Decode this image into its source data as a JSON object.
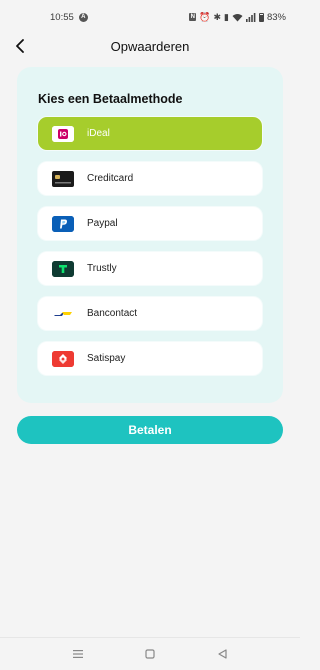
{
  "status_bar": {
    "time": "10:55",
    "alert_badge": "A",
    "nfc_badge": "N",
    "battery": "83%"
  },
  "header": {
    "title": "Opwaarderen"
  },
  "card": {
    "heading": "Kies een Betaalmethode"
  },
  "payment_methods": [
    {
      "label": "iDeal",
      "icon": "ideal-icon",
      "selected": true
    },
    {
      "label": "Creditcard",
      "icon": "creditcard-icon",
      "selected": false
    },
    {
      "label": "Paypal",
      "icon": "paypal-icon",
      "selected": false
    },
    {
      "label": "Trustly",
      "icon": "trustly-icon",
      "selected": false
    },
    {
      "label": "Bancontact",
      "icon": "bancontact-icon",
      "selected": false
    },
    {
      "label": "Satispay",
      "icon": "satispay-icon",
      "selected": false
    }
  ],
  "pay_button": {
    "label": "Betalen"
  },
  "colors": {
    "accent_teal": "#1ec3c0",
    "selected_green": "#a6cd2c",
    "card_background": "#e4f6f5",
    "page_background": "#f4f4f4"
  }
}
